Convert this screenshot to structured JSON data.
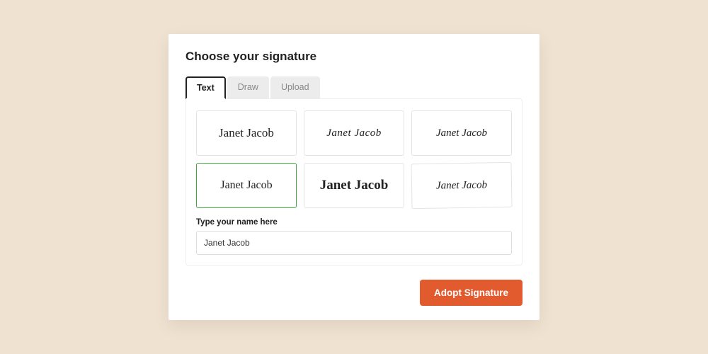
{
  "title": "Choose your signature",
  "tabs": {
    "text": {
      "label": "Text",
      "active": true
    },
    "draw": {
      "label": "Draw",
      "active": false
    },
    "upload": {
      "label": "Upload",
      "active": false
    }
  },
  "signature_name": "Janet Jacob",
  "styles": [
    {
      "id": 0,
      "selected": false
    },
    {
      "id": 1,
      "selected": false
    },
    {
      "id": 2,
      "selected": false
    },
    {
      "id": 3,
      "selected": true
    },
    {
      "id": 4,
      "selected": false
    },
    {
      "id": 5,
      "selected": false
    }
  ],
  "field_label": "Type your name here",
  "name_input_value": "Janet Jacob",
  "adopt_button": "Adopt Signature",
  "colors": {
    "accent": "#e25b2f",
    "selected_border": "#3fa83f"
  }
}
